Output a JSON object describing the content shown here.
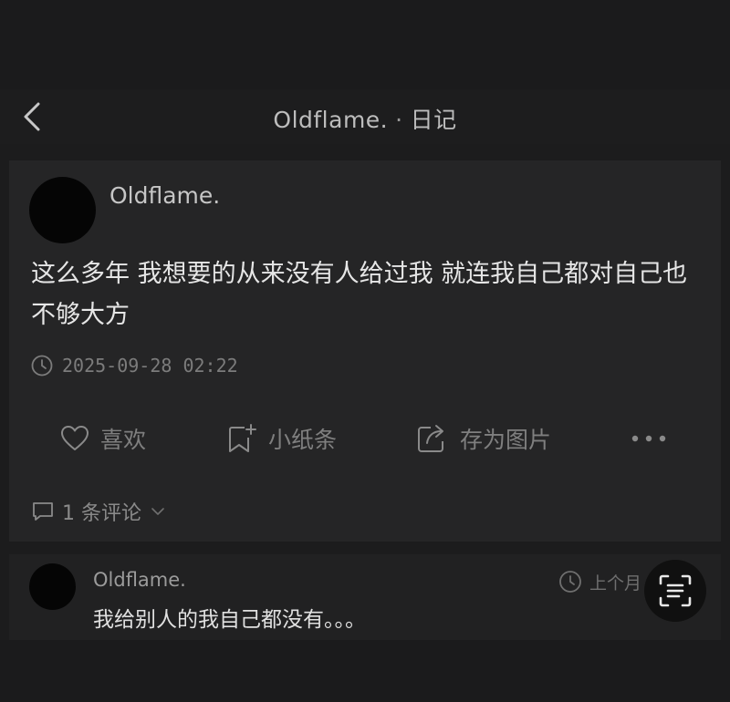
{
  "nav": {
    "title_name": "Oldflame.",
    "title_dot": "·",
    "title_section": "日记",
    "back_icon": "chevron-left-icon"
  },
  "post": {
    "author": "Oldflame.",
    "body": "这么多年 我想要的从来没有人给过我 就连我自己都对自己也不够大方",
    "timestamp": "2025-09-28 02:22"
  },
  "actions": {
    "like_label": "喜欢",
    "note_label": "小纸条",
    "save_image_label": "存为图片",
    "more_icon": "more-dots-icon"
  },
  "comments": {
    "count_label": "1 条评论",
    "items": [
      {
        "author": "Oldflame.",
        "text": "我给别人的我自己都没有。。。",
        "time": "上个月"
      }
    ]
  },
  "colors": {
    "background": "#1c1c1d",
    "card": "#252526",
    "text_primary": "#e6e6e6",
    "text_muted": "#7f7f7f"
  }
}
